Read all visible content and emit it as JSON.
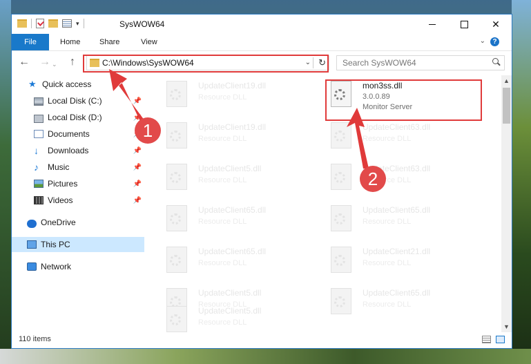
{
  "window": {
    "title": "SysWOW64"
  },
  "ribbon": {
    "tabs": [
      "File",
      "Home",
      "Share",
      "View"
    ],
    "help_label": "?"
  },
  "nav": {
    "address": "C:\\Windows\\SysWOW64",
    "search_placeholder": "Search SysWOW64"
  },
  "sidebar": {
    "items": [
      {
        "label": "Quick access",
        "icon": "star-icon"
      },
      {
        "label": "Local Disk (C:)",
        "icon": "drive-icon"
      },
      {
        "label": "Local Disk (D:)",
        "icon": "drive-icon"
      },
      {
        "label": "Documents",
        "icon": "documents-icon"
      },
      {
        "label": "Downloads",
        "icon": "downloads-icon"
      },
      {
        "label": "Music",
        "icon": "music-icon"
      },
      {
        "label": "Pictures",
        "icon": "pictures-icon"
      },
      {
        "label": "Videos",
        "icon": "videos-icon"
      },
      {
        "label": "OneDrive",
        "icon": "cloud-icon"
      },
      {
        "label": "This PC",
        "icon": "computer-icon"
      },
      {
        "label": "Network",
        "icon": "network-icon"
      }
    ]
  },
  "files": {
    "left": [
      {
        "name": "UpdateClient19.dll",
        "type": "Resource DLL"
      },
      {
        "name": "UpdateClient19.dll",
        "type": "Resource DLL"
      },
      {
        "name": "UpdateClient5.dll",
        "type": "Resource DLL"
      },
      {
        "name": "UpdateClient65.dll",
        "type": "Resource DLL"
      },
      {
        "name": "UpdateClient65.dll",
        "type": "Resource DLL"
      },
      {
        "name": "UpdateClient5.dll",
        "type": "Resource DLL"
      },
      {
        "name": "UpdateClient5.dll",
        "type": "Resource DLL"
      }
    ],
    "highlighted": {
      "name": "mon3ss.dll",
      "version": "3.0.0.89",
      "description": "Monitor Server"
    },
    "right": [
      {
        "name": "UpdateClient63.dll",
        "type": "Resource DLL"
      },
      {
        "name": "UpdateClient63.dll",
        "type": "Resource DLL"
      },
      {
        "name": "UpdateClient65.dll",
        "type": "Resource DLL"
      },
      {
        "name": "UpdateClient21.dll",
        "type": "Resource DLL"
      },
      {
        "name": "UpdateClient65.dll",
        "type": "Resource DLL"
      }
    ]
  },
  "status": {
    "item_count": "110 items"
  },
  "annotations": {
    "step1": "1",
    "step2": "2",
    "color": "#e03a3a"
  }
}
